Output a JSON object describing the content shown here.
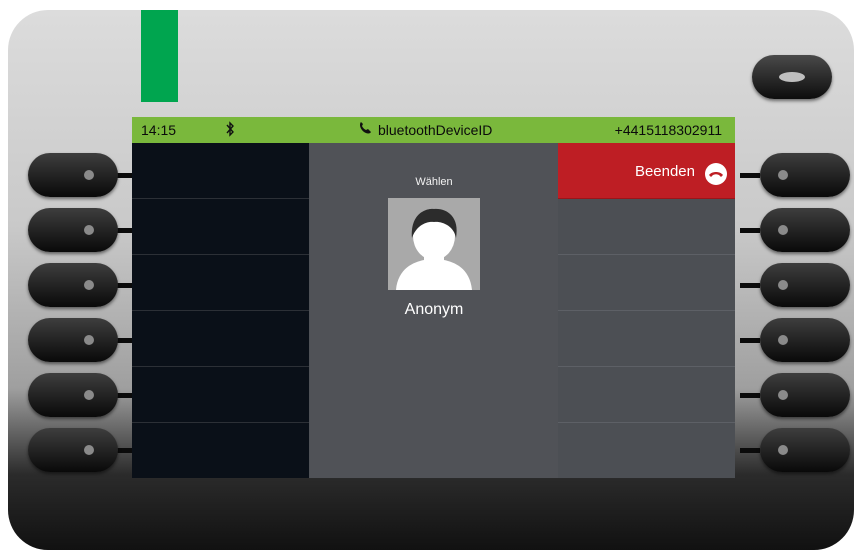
{
  "status_bar": {
    "time": "14:15",
    "bluetooth_icon": "bluetooth-icon",
    "device_id_icon": "handset-icon",
    "device_id": "bluetoothDeviceID",
    "phone_number": "+4415118302911"
  },
  "call": {
    "state": "Wählen",
    "contact_name": "Anonym",
    "avatar_icon": "person-icon"
  },
  "right_keys": {
    "end_call_label": "Beenden",
    "end_call_icon": "hangup-icon"
  },
  "colors": {
    "status_bar": "#7ab83c",
    "end_call": "#be1e24",
    "led": "#00a54f"
  }
}
